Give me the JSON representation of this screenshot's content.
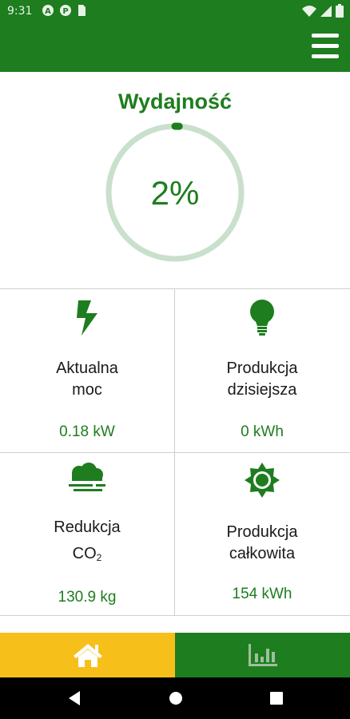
{
  "status_bar": {
    "time": "9:31",
    "icons": [
      "a-circle-icon",
      "p-circle-icon",
      "sim-icon"
    ],
    "right_icons": [
      "wifi-icon",
      "signal-icon",
      "battery-icon"
    ]
  },
  "app_bar": {
    "menu_icon": "hamburger-menu-icon"
  },
  "colors": {
    "primary": "#1e7d1e",
    "accent": "#f7bf1a",
    "gauge_track": "#c9e0cc"
  },
  "efficiency": {
    "title": "Wydajność",
    "value_text": "2%",
    "percent": 2
  },
  "tiles": [
    {
      "icon": "lightning-bolt-icon",
      "label_line1": "Aktualna",
      "label_line2": "moc",
      "value": "0.18 kW"
    },
    {
      "icon": "light-bulb-icon",
      "label_line1": "Produkcja",
      "label_line2": "dzisiejsza",
      "value": "0 kWh"
    },
    {
      "icon": "cloud-icon",
      "label_line1": "Redukcja",
      "label_line2": "CO",
      "label_sub": "2",
      "value": "130.9 kg"
    },
    {
      "icon": "sun-icon",
      "label_line1": "Produkcja",
      "label_line2": "całkowita",
      "value": "154 kWh"
    }
  ],
  "bottom_nav": [
    {
      "icon": "home-icon",
      "active": true
    },
    {
      "icon": "bar-chart-icon",
      "active": false
    }
  ],
  "system_nav": [
    "back-icon",
    "home-circle-icon",
    "recents-icon"
  ]
}
